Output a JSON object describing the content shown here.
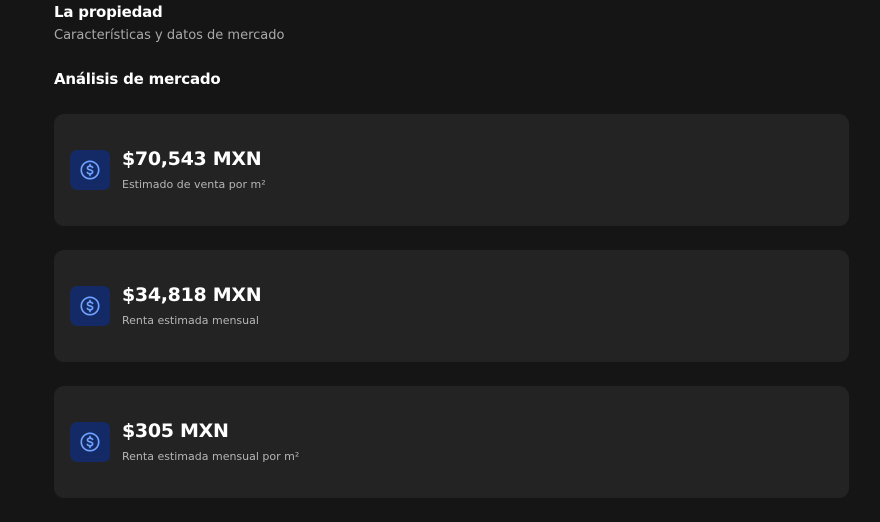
{
  "property": {
    "title": "La propiedad",
    "subtitle": "Características y datos de mercado"
  },
  "analysis": {
    "heading": "Análisis de mercado",
    "cards": [
      {
        "value": "$70,543 MXN",
        "label": "Estimado de venta por m²",
        "icon": "dollar-coin-icon"
      },
      {
        "value": "$34,818 MXN",
        "label": "Renta estimada mensual",
        "icon": "dollar-coin-icon"
      },
      {
        "value": "$305 MXN",
        "label": "Renta estimada mensual por m²",
        "icon": "dollar-coin-icon"
      }
    ]
  },
  "colors": {
    "background": "#151515",
    "card": "#232323",
    "icon_bg": "#142a66",
    "icon_fg": "#6fa3ff"
  }
}
